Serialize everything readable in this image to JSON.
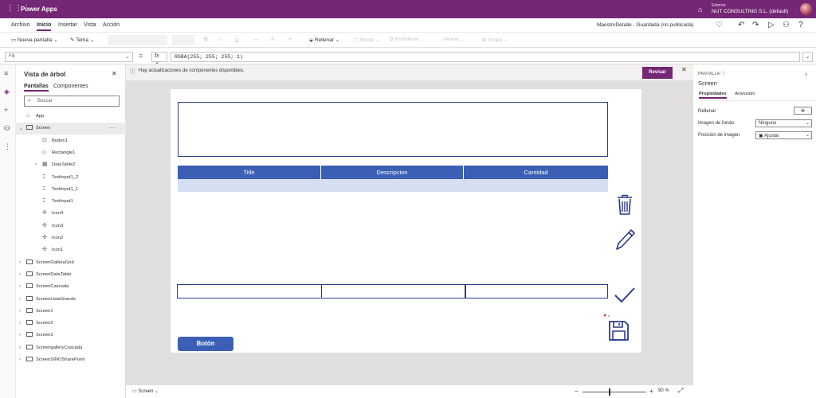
{
  "app": {
    "name": "Power Apps"
  },
  "environment": {
    "label": "Entorno",
    "name": "NUT CONSULTING S.L. (default)"
  },
  "menu": {
    "items": [
      "Archivo",
      "Inicio",
      "Insertar",
      "Vista",
      "Acción"
    ],
    "active": "Inicio",
    "doc_status": "MaestroDetalle - Guardada (no publicada)"
  },
  "ribbon": {
    "new_screen": "Nueva pantalla",
    "theme": "Tema",
    "fill": "Rellenar",
    "border": "Borde",
    "reorder": "Reordenar",
    "align": "Alinear",
    "group": "Grupo"
  },
  "formula": {
    "property": "Fill",
    "eq": "=",
    "fx": "fx",
    "value": "RGBA(255; 255; 255; 1)"
  },
  "tree": {
    "title": "Vista de árbol",
    "tabs": [
      "Pantallas",
      "Componentes"
    ],
    "search_placeholder": "Buscar",
    "nodes": [
      {
        "label": "App",
        "icon": "app-icon",
        "level": 0,
        "expand": ""
      },
      {
        "label": "Screen",
        "icon": "screen-icon",
        "level": 0,
        "expand": "⌄",
        "selected": true
      },
      {
        "label": "Button1",
        "icon": "button-icon",
        "level": 1,
        "expand": ""
      },
      {
        "label": "Rectangle1",
        "icon": "shape-icon",
        "level": 1,
        "expand": ""
      },
      {
        "label": "DataTable2",
        "icon": "table-icon",
        "level": 1,
        "expand": "›"
      },
      {
        "label": "TextInput1_2",
        "icon": "textinput-icon",
        "level": 1,
        "expand": ""
      },
      {
        "label": "TextInput1_1",
        "icon": "textinput-icon",
        "level": 1,
        "expand": ""
      },
      {
        "label": "TextInput1",
        "icon": "textinput-icon",
        "level": 1,
        "expand": ""
      },
      {
        "label": "Icon4",
        "icon": "icon-control-icon",
        "level": 1,
        "expand": ""
      },
      {
        "label": "Icon3",
        "icon": "icon-control-icon",
        "level": 1,
        "expand": ""
      },
      {
        "label": "Icon2",
        "icon": "icon-control-icon",
        "level": 1,
        "expand": ""
      },
      {
        "label": "Icon1",
        "icon": "icon-control-icon",
        "level": 1,
        "expand": ""
      },
      {
        "label": "ScreenGalleryGrid",
        "icon": "screen-icon",
        "level": 0,
        "expand": "›"
      },
      {
        "label": "ScreenDataTable",
        "icon": "screen-icon",
        "level": 0,
        "expand": "›"
      },
      {
        "label": "ScreenCascada",
        "icon": "screen-icon",
        "level": 0,
        "expand": "›"
      },
      {
        "label": "ScreenListaGrande",
        "icon": "screen-icon",
        "level": 0,
        "expand": "›"
      },
      {
        "label": "Screen1",
        "icon": "screen-icon",
        "level": 0,
        "expand": "›"
      },
      {
        "label": "Screen2",
        "icon": "screen-icon",
        "level": 0,
        "expand": "›"
      },
      {
        "label": "Screen3",
        "icon": "screen-icon",
        "level": 0,
        "expand": "›"
      },
      {
        "label": "ScreengalleryCascada",
        "icon": "screen-icon",
        "level": 0,
        "expand": "›"
      },
      {
        "label": "ScreenSINOSharePoint",
        "icon": "screen-icon",
        "level": 0,
        "expand": "›"
      }
    ]
  },
  "notice": {
    "message": "Hay actualizaciones de componentes disponibles.",
    "review": "Revisar"
  },
  "canvas": {
    "table_headers": [
      "Title",
      "Descripcion",
      "Cantidad"
    ],
    "button_label": "Botón",
    "colors": {
      "header": "#3a5fb4",
      "row": "#d6dff2",
      "border": "#2b3a8c"
    }
  },
  "footer": {
    "screen": "Screen",
    "zoom": "90",
    "zoom_unit": "%"
  },
  "props": {
    "category": "PANTALLA",
    "name": "Screen",
    "tabs": [
      "Propiedades",
      "Avanzado"
    ],
    "fill_label": "Rellenar",
    "bg_image_label": "Imagen de fondo",
    "bg_image_value": "Ninguno",
    "image_pos_label": "Posición de imagen",
    "image_pos_value": "Ajustar"
  }
}
